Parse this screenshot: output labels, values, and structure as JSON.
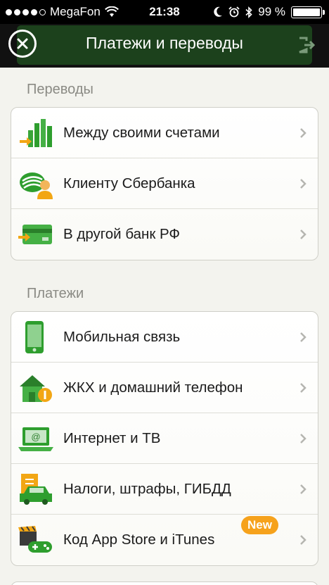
{
  "status_bar": {
    "carrier": "MegaFon",
    "time": "21:38",
    "battery_percent": "99 %"
  },
  "header": {
    "title": "Платежи и переводы"
  },
  "sections": [
    {
      "title": "Переводы",
      "items": [
        {
          "label": "Между своими счетами",
          "icon": "transfer-between-accounts-icon"
        },
        {
          "label": "Клиенту Сбербанка",
          "icon": "sberbank-client-icon"
        },
        {
          "label": "В другой банк РФ",
          "icon": "bank-card-transfer-icon"
        }
      ]
    },
    {
      "title": "Платежи",
      "items": [
        {
          "label": "Мобильная связь",
          "icon": "mobile-phone-icon"
        },
        {
          "label": "ЖКХ и домашний телефон",
          "icon": "house-icon"
        },
        {
          "label": "Интернет и ТВ",
          "icon": "laptop-icon"
        },
        {
          "label": "Налоги, штрафы, ГИБДД",
          "icon": "car-icon"
        },
        {
          "label": "Код App Store и iTunes",
          "icon": "gamepad-icon",
          "badge": "New"
        }
      ]
    }
  ],
  "colors": {
    "brand_green": "#2e9e2e",
    "badge_orange": "#f6a21c"
  }
}
